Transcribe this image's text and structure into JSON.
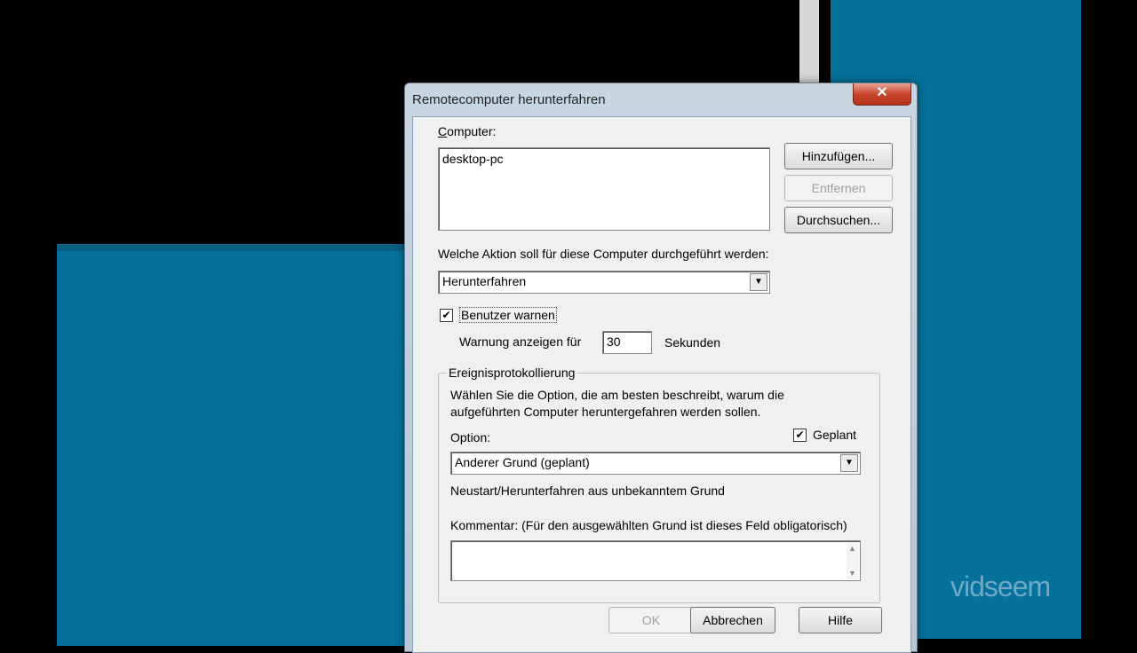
{
  "window": {
    "title": "Remotecomputer herunterfahren",
    "close_label": "✕"
  },
  "computer": {
    "label_prefix": "",
    "label_u": "C",
    "label_rest": "omputer:",
    "list_items": [
      "desktop-pc"
    ]
  },
  "buttons": {
    "add": "Hinzufügen...",
    "remove": "Entfernen",
    "browse": "Durchsuchen...",
    "ok": "OK",
    "cancel": "Abbrechen",
    "help": "Hilfe"
  },
  "action": {
    "label": "Welche Aktion soll für diese Computer durchgeführt werden:",
    "selected": "Herunterfahren"
  },
  "warn": {
    "checkbox_label": "Benutzer warnen",
    "checked": true,
    "show_warning_label": "Warnung anzeigen für",
    "seconds_value": "30",
    "seconds_label": "Sekunden"
  },
  "event_log": {
    "group_title": "Ereignisprotokollierung",
    "description_line1": "Wählen Sie die Option, die am besten beschreibt, warum die",
    "description_line2": "aufgeführten Computer heruntergefahren werden sollen.",
    "option_label": "Option:",
    "planned_label": "Geplant",
    "planned_checked": true,
    "option_selected": "Anderer Grund (geplant)",
    "option_description": "Neustart/Herunterfahren aus unbekanntem Grund",
    "comment_label": "Kommentar: (Für den ausgewählten Grund ist dieses Feld obligatorisch)"
  },
  "watermark": "vidseem",
  "icons": {
    "checkmark": "✔",
    "dropdown": "▼",
    "scroll_up": "▲",
    "scroll_down": "▼"
  }
}
